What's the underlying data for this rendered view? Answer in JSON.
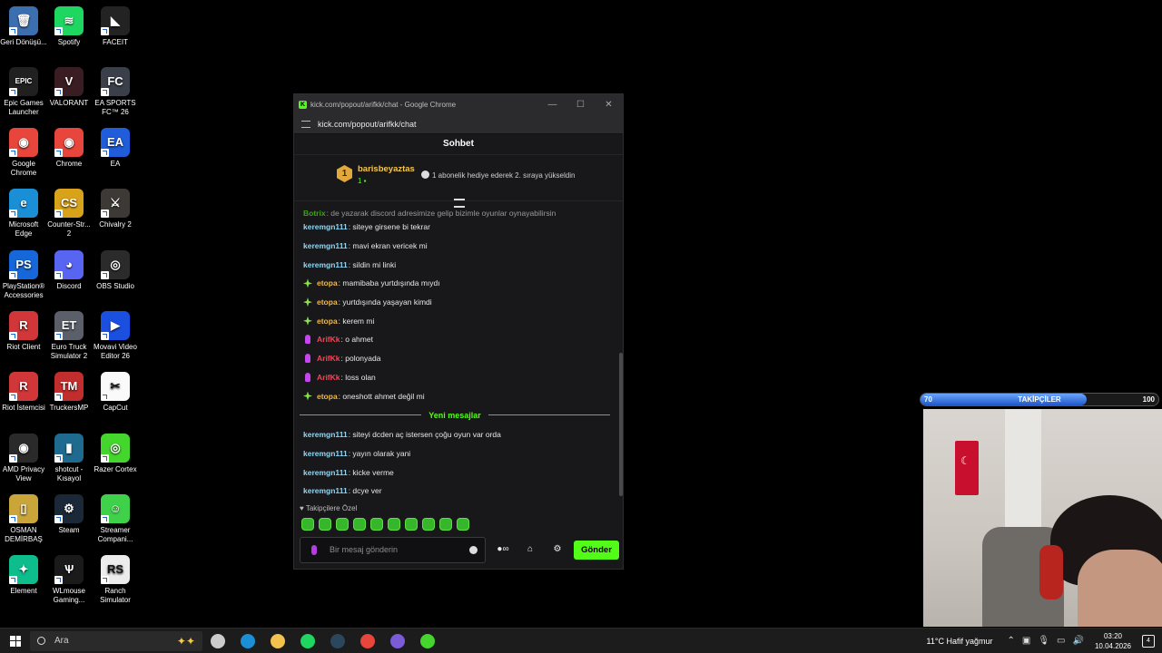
{
  "desktop": {
    "icons": [
      {
        "label": "Geri Dönüşü...",
        "color": "#3b6fb0",
        "glyph": "🗑"
      },
      {
        "label": "Spotify",
        "color": "#1ed760",
        "glyph": "≋"
      },
      {
        "label": "FACEIT",
        "color": "#232323",
        "glyph": "◣"
      },
      {
        "label": "Epic Games Launcher",
        "color": "#202020",
        "glyph": "EPIC"
      },
      {
        "label": "VALORANT",
        "color": "#3a1d22",
        "glyph": "V"
      },
      {
        "label": "EA SPORTS FC™ 26",
        "color": "#3a3f4a",
        "glyph": "FC"
      },
      {
        "label": "Google Chrome",
        "color": "#e8453c",
        "glyph": "◉"
      },
      {
        "label": "Chrome",
        "color": "#e8453c",
        "glyph": "◉"
      },
      {
        "label": "EA",
        "color": "#1f5ddb",
        "glyph": "EA"
      },
      {
        "label": "Microsoft Edge",
        "color": "#1b8fd6",
        "glyph": "e"
      },
      {
        "label": "Counter-Str... 2",
        "color": "#d9a21b",
        "glyph": "CS"
      },
      {
        "label": "Chivalry 2",
        "color": "#3d3a35",
        "glyph": "⚔"
      },
      {
        "label": "PlayStation® Accessories",
        "color": "#1667d9",
        "glyph": "PS"
      },
      {
        "label": "Discord",
        "color": "#5865f2",
        "glyph": "◕"
      },
      {
        "label": "OBS Studio",
        "color": "#2b2b2b",
        "glyph": "◎"
      },
      {
        "label": "Riot Client",
        "color": "#d13639",
        "glyph": "R"
      },
      {
        "label": "Euro Truck Simulator 2",
        "color": "#5a5f69",
        "glyph": "ET"
      },
      {
        "label": "Movavi Video Editor 26",
        "color": "#1a4fe0",
        "glyph": "▶"
      },
      {
        "label": "Riot İstemcisi",
        "color": "#d13639",
        "glyph": "R"
      },
      {
        "label": "TruckersMP",
        "color": "#c22d2d",
        "glyph": "TM"
      },
      {
        "label": "CapCut",
        "color": "#fafafa",
        "glyph": "✂"
      },
      {
        "label": "AMD Privacy View",
        "color": "#2a2a2a",
        "glyph": "◉"
      },
      {
        "label": "shotcut - Kısayol",
        "color": "#1f6b8f",
        "glyph": "▮"
      },
      {
        "label": "Razer Cortex",
        "color": "#44d62c",
        "glyph": "◎"
      },
      {
        "label": "OSMAN DEMİRBAŞ",
        "color": "#c9a53a",
        "glyph": "▯"
      },
      {
        "label": "Steam",
        "color": "#1b2838",
        "glyph": "⚙"
      },
      {
        "label": "Streamer Compani...",
        "color": "#3fd14a",
        "glyph": "☺"
      },
      {
        "label": "Element",
        "color": "#0dbd8b",
        "glyph": "✦"
      },
      {
        "label": "WLmouse Gaming...",
        "color": "#1a1a1a",
        "glyph": "Ѱ"
      },
      {
        "label": "Ranch Simulator",
        "color": "#ececec",
        "glyph": "RS"
      }
    ]
  },
  "window": {
    "title": "kick.com/popout/arifkk/chat - Google Chrome",
    "url": "kick.com/popout/arifkk/chat",
    "controls": [
      "—",
      "☐",
      "✕"
    ]
  },
  "chat": {
    "header": "Sohbet",
    "pinned": {
      "badge": "1",
      "user": "barisbeyaztas",
      "count": "1",
      "text": "1 abonelik hediye ederek 2. sıraya yükseldin"
    },
    "cut_message": {
      "user": "Botrix",
      "text": ": de yazarak discord adresimize gelip bizimle oyunlar oynayabilirsin"
    },
    "messages": [
      {
        "user": "keremgn111",
        "text": ": siteye girsene bi tekrar",
        "color": "#8fd7f5",
        "icon": ""
      },
      {
        "user": "keremgn111",
        "text": ": mavi ekran vericek mi",
        "color": "#8fd7f5",
        "icon": ""
      },
      {
        "user": "keremgn111",
        "text": ": sildin mi linki",
        "color": "#8fd7f5",
        "icon": ""
      },
      {
        "user": "etopa",
        "text": ": mamibaba yurtdışında mıydı",
        "color": "#f2b84b",
        "icon": "spark"
      },
      {
        "user": "etopa",
        "text": ": yurtdışında yaşayan kimdi",
        "color": "#f2b84b",
        "icon": "spark"
      },
      {
        "user": "etopa",
        "text": ": kerem mi",
        "color": "#f2b84b",
        "icon": "spark"
      },
      {
        "user": "ArifKk",
        "text": ": o ahmet",
        "color": "#f0485a",
        "icon": "mic"
      },
      {
        "user": "ArifKk",
        "text": ": polonyada",
        "color": "#f0485a",
        "icon": "mic"
      },
      {
        "user": "ArifKk",
        "text": ": loss olan",
        "color": "#f0485a",
        "icon": "mic"
      },
      {
        "user": "etopa",
        "text": ": oneshott ahmet değil mi",
        "color": "#f2b84b",
        "icon": "spark"
      }
    ],
    "new_messages_label": "Yeni mesajlar",
    "new_messages": [
      {
        "user": "keremgn111",
        "text": ": siteyi dcden aç istersen çoğu oyun var orda",
        "color": "#8fd7f5"
      },
      {
        "user": "keremgn111",
        "text": ": yayın olarak yani",
        "color": "#8fd7f5"
      },
      {
        "user": "keremgn111",
        "text": ": kicke verme",
        "color": "#8fd7f5"
      },
      {
        "user": "keremgn111",
        "text": ": dcye ver",
        "color": "#8fd7f5"
      }
    ],
    "emotes_label": "♥ Takipçilere Özel",
    "emote_count": 10,
    "input_placeholder": "Bir mesaj gönderin",
    "tools": [
      "●∞",
      "⌂",
      "⚙"
    ],
    "send_label": "Gönder"
  },
  "overlay": {
    "follow_label": "TAKİPÇİLER",
    "current": "70",
    "goal": "100",
    "progress": 0.7
  },
  "taskbar": {
    "search_placeholder": "Ara",
    "apps": [
      {
        "name": "task-view",
        "color": "#cccccc"
      },
      {
        "name": "edge",
        "color": "#1b8fd6"
      },
      {
        "name": "file-explorer",
        "color": "#f2c14e"
      },
      {
        "name": "spotify",
        "color": "#1ed760"
      },
      {
        "name": "steam",
        "color": "#2a475e"
      },
      {
        "name": "chrome",
        "color": "#e8453c"
      },
      {
        "name": "obs",
        "color": "#7b5cd6"
      },
      {
        "name": "razer",
        "color": "#44d62c"
      }
    ],
    "weather": "11°C  Hafif yağmur",
    "time": "03:20",
    "date": "10.04.2026",
    "notifications": "4"
  }
}
